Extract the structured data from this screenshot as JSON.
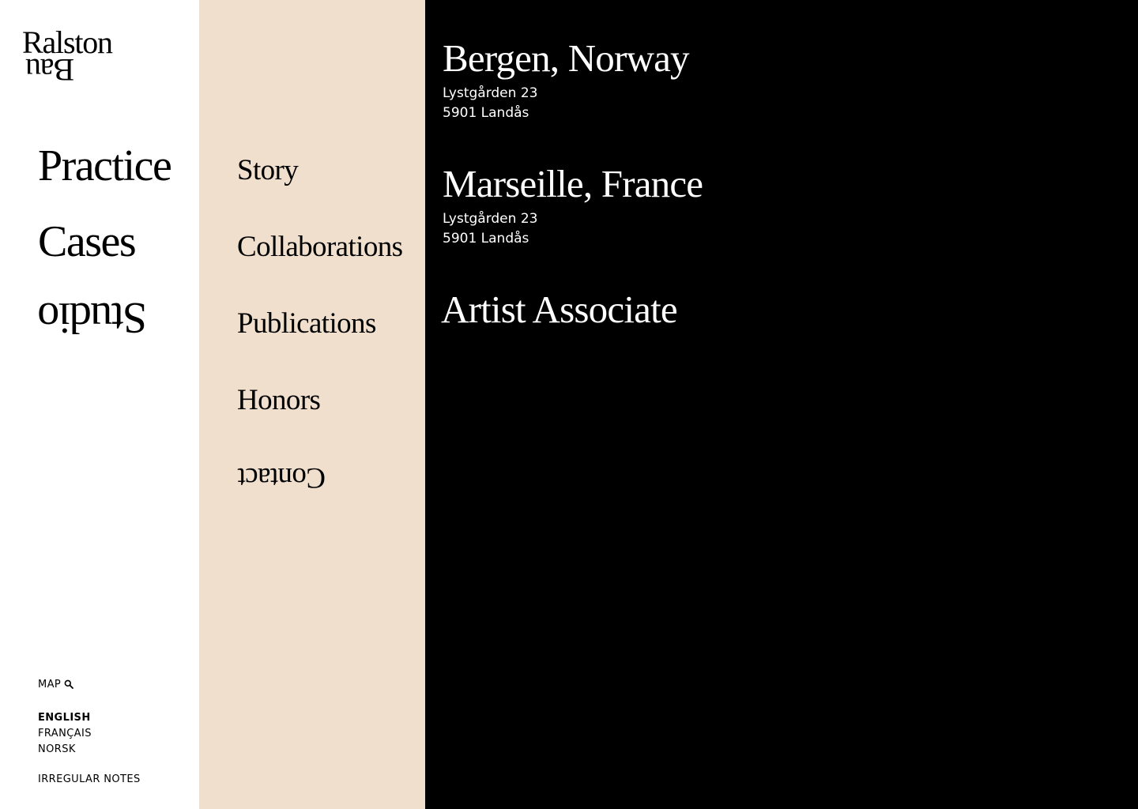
{
  "brand": {
    "logo_line1": "Ralston",
    "logo_line2": "Bau"
  },
  "primary_nav": [
    {
      "label": "Practice"
    },
    {
      "label": "Cases"
    },
    {
      "label": "Studio"
    }
  ],
  "secondary_nav": [
    {
      "label": "Story"
    },
    {
      "label": "Collaborations"
    },
    {
      "label": "Publications"
    },
    {
      "label": "Honors"
    },
    {
      "label": "Contact"
    }
  ],
  "offices": [
    {
      "title": "Bergen, Norway",
      "address_line1": "Lystgården 23",
      "address_line2": "5901 Landås"
    },
    {
      "title": "Marseille, France",
      "address_line1": "Lystgården 23",
      "address_line2": "5901 Landås"
    },
    {
      "title": "Artist Associate"
    }
  ],
  "utility": {
    "map_label": "MAP",
    "map_icon": "search-icon",
    "languages": [
      {
        "label": "ENGLISH",
        "active": true
      },
      {
        "label": "FRANÇAIS",
        "active": false
      },
      {
        "label": "NORSK",
        "active": false
      }
    ],
    "notes_label": "IRREGULAR NOTES"
  },
  "colors": {
    "primary_bg": "#ffffff",
    "secondary_bg": "#f0dfcc",
    "content_bg": "#000000",
    "content_text": "#ffffff"
  }
}
